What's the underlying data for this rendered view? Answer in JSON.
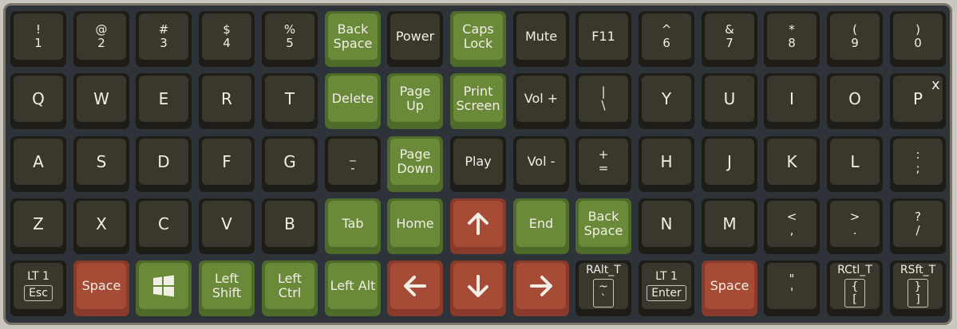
{
  "keyboard": {
    "close_label": "x",
    "rows": [
      [
        {
          "style": "dark",
          "lines": [
            "!",
            "1"
          ]
        },
        {
          "style": "dark",
          "lines": [
            "@",
            "2"
          ]
        },
        {
          "style": "dark",
          "lines": [
            "#",
            "3"
          ]
        },
        {
          "style": "dark",
          "lines": [
            "$",
            "4"
          ]
        },
        {
          "style": "dark",
          "lines": [
            "%",
            "5"
          ]
        },
        {
          "style": "green",
          "lines": [
            "Back",
            "Space"
          ]
        },
        {
          "style": "dark",
          "lines": [
            "Power"
          ]
        },
        {
          "style": "green",
          "lines": [
            "Caps",
            "Lock"
          ]
        },
        {
          "style": "dark",
          "lines": [
            "Mute"
          ]
        },
        {
          "style": "dark",
          "lines": [
            "F11"
          ]
        },
        {
          "style": "dark",
          "lines": [
            "^",
            "6"
          ]
        },
        {
          "style": "dark",
          "lines": [
            "&",
            "7"
          ]
        },
        {
          "style": "dark",
          "lines": [
            "*",
            "8"
          ]
        },
        {
          "style": "dark",
          "lines": [
            "(",
            "9"
          ]
        },
        {
          "style": "dark",
          "lines": [
            ")",
            "0"
          ]
        }
      ],
      [
        {
          "style": "dark",
          "lines": [
            "Q"
          ]
        },
        {
          "style": "dark",
          "lines": [
            "W"
          ]
        },
        {
          "style": "dark",
          "lines": [
            "E"
          ]
        },
        {
          "style": "dark",
          "lines": [
            "R"
          ]
        },
        {
          "style": "dark",
          "lines": [
            "T"
          ]
        },
        {
          "style": "green",
          "lines": [
            "Delete"
          ]
        },
        {
          "style": "green",
          "lines": [
            "Page",
            "Up"
          ]
        },
        {
          "style": "green",
          "lines": [
            "Print",
            "Screen"
          ]
        },
        {
          "style": "dark",
          "lines": [
            "Vol +"
          ]
        },
        {
          "style": "dark",
          "lines": [
            "|",
            "\\"
          ]
        },
        {
          "style": "dark",
          "lines": [
            "Y"
          ]
        },
        {
          "style": "dark",
          "lines": [
            "U"
          ]
        },
        {
          "style": "dark",
          "lines": [
            "I"
          ]
        },
        {
          "style": "dark",
          "lines": [
            "O"
          ]
        },
        {
          "style": "dark",
          "lines": [
            "P"
          ]
        }
      ],
      [
        {
          "style": "dark",
          "lines": [
            "A"
          ]
        },
        {
          "style": "dark",
          "lines": [
            "S"
          ]
        },
        {
          "style": "dark",
          "lines": [
            "D"
          ]
        },
        {
          "style": "dark",
          "lines": [
            "F"
          ]
        },
        {
          "style": "dark",
          "lines": [
            "G"
          ]
        },
        {
          "style": "dark",
          "lines": [
            "_",
            "-"
          ]
        },
        {
          "style": "green",
          "lines": [
            "Page",
            "Down"
          ]
        },
        {
          "style": "dark",
          "lines": [
            "Play"
          ]
        },
        {
          "style": "dark",
          "lines": [
            "Vol -"
          ]
        },
        {
          "style": "dark",
          "lines": [
            "+",
            "="
          ]
        },
        {
          "style": "dark",
          "lines": [
            "H"
          ]
        },
        {
          "style": "dark",
          "lines": [
            "J"
          ]
        },
        {
          "style": "dark",
          "lines": [
            "K"
          ]
        },
        {
          "style": "dark",
          "lines": [
            "L"
          ]
        },
        {
          "style": "dark",
          "lines": [
            ":",
            ";"
          ]
        }
      ],
      [
        {
          "style": "dark",
          "lines": [
            "Z"
          ]
        },
        {
          "style": "dark",
          "lines": [
            "X"
          ]
        },
        {
          "style": "dark",
          "lines": [
            "C"
          ]
        },
        {
          "style": "dark",
          "lines": [
            "V"
          ]
        },
        {
          "style": "dark",
          "lines": [
            "B"
          ]
        },
        {
          "style": "green",
          "lines": [
            "Tab"
          ]
        },
        {
          "style": "green",
          "lines": [
            "Home"
          ]
        },
        {
          "style": "red",
          "icon": "arrow-up-icon"
        },
        {
          "style": "green",
          "lines": [
            "End"
          ]
        },
        {
          "style": "green",
          "lines": [
            "Back",
            "Space"
          ]
        },
        {
          "style": "dark",
          "lines": [
            "N"
          ]
        },
        {
          "style": "dark",
          "lines": [
            "M"
          ]
        },
        {
          "style": "dark",
          "lines": [
            "<",
            ","
          ]
        },
        {
          "style": "dark",
          "lines": [
            ">",
            "."
          ]
        },
        {
          "style": "dark",
          "lines": [
            "?",
            "/"
          ]
        }
      ],
      [
        {
          "style": "dark",
          "hold": "LT 1",
          "tap": [
            "Esc"
          ]
        },
        {
          "style": "red",
          "lines": [
            "Space"
          ]
        },
        {
          "style": "green",
          "icon": "windows-logo-icon"
        },
        {
          "style": "green",
          "lines": [
            "Left",
            "Shift"
          ]
        },
        {
          "style": "green",
          "lines": [
            "Left",
            "Ctrl"
          ]
        },
        {
          "style": "green",
          "lines": [
            "Left Alt"
          ]
        },
        {
          "style": "red",
          "icon": "arrow-left-icon"
        },
        {
          "style": "red",
          "icon": "arrow-down-icon"
        },
        {
          "style": "red",
          "icon": "arrow-right-icon"
        },
        {
          "style": "dark",
          "hold": "RAlt_T",
          "tap": [
            "~",
            "`"
          ]
        },
        {
          "style": "dark",
          "hold": "LT 1",
          "tap": [
            "Enter"
          ]
        },
        {
          "style": "red",
          "lines": [
            "Space"
          ]
        },
        {
          "style": "dark",
          "lines": [
            "\"",
            "'"
          ]
        },
        {
          "style": "dark",
          "hold": "RCtl_T",
          "tap": [
            "{",
            "["
          ]
        },
        {
          "style": "dark",
          "hold": "RSft_T",
          "tap": [
            "}",
            "]"
          ]
        }
      ]
    ]
  }
}
